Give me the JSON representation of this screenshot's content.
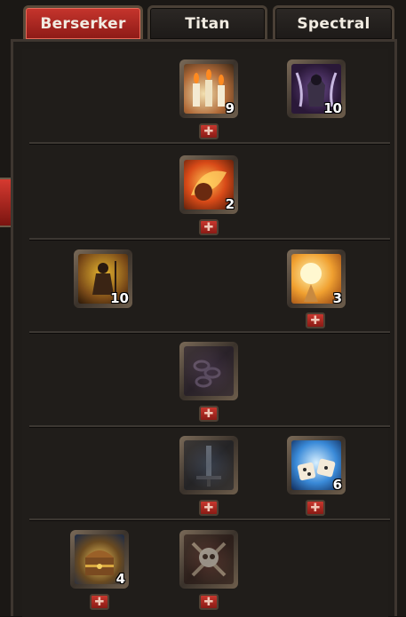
{
  "tabs": [
    {
      "label": "Berserker",
      "active": true
    },
    {
      "label": "Titan",
      "active": false
    },
    {
      "label": "Spectral",
      "active": false
    }
  ],
  "skills": {
    "r1_candles": {
      "icon": "candles-icon",
      "level": "9"
    },
    "r1_reaper": {
      "icon": "reaper-icon",
      "level": "10"
    },
    "r2_fire": {
      "icon": "fire-fist-icon",
      "level": "2"
    },
    "r3_hunter": {
      "icon": "hunter-icon",
      "level": "10"
    },
    "r3_sun": {
      "icon": "sun-strike-icon",
      "level": "3"
    },
    "r4_chain": {
      "icon": "chain-icon",
      "level": ""
    },
    "r5_sword": {
      "icon": "sword-icon",
      "level": ""
    },
    "r5_dice": {
      "icon": "dice-icon",
      "level": "6"
    },
    "r6_chest": {
      "icon": "treasure-chest-icon",
      "level": "4"
    },
    "r6_skull": {
      "icon": "skull-icon",
      "level": ""
    }
  },
  "plus_symbol": "✚",
  "colors": {
    "accent": "#b8281f",
    "panel": "#201d1a",
    "divider": "#3c3732"
  }
}
